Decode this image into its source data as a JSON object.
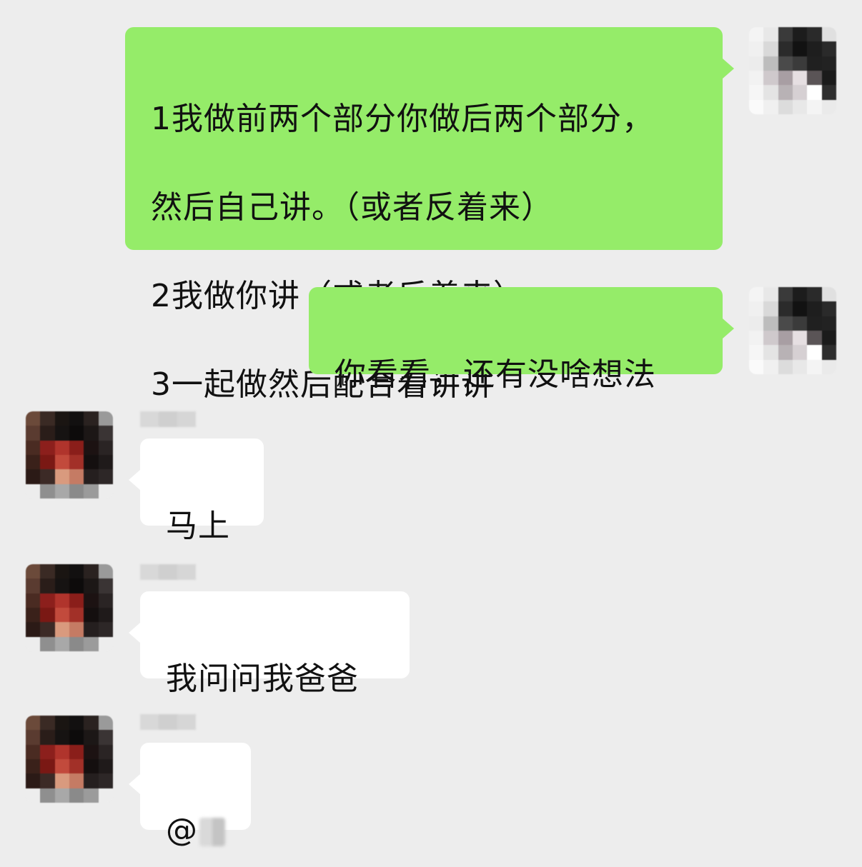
{
  "chat": {
    "messages": [
      {
        "sender": "me",
        "lines": [
          "1我做前两个部分你做后两个部分，",
          "然后自己讲。（或者反着来）",
          "2我做你讲（或者反着来）。",
          "3一起做然后配合着讲讲"
        ]
      },
      {
        "sender": "me",
        "text": "你看看，还有没啥想法"
      },
      {
        "sender": "other",
        "text": "马上"
      },
      {
        "sender": "other",
        "text": "我问问我爸爸"
      },
      {
        "sender": "other",
        "text": "@"
      }
    ]
  },
  "colors": {
    "background": "#ededed",
    "my_bubble": "#95ec69",
    "their_bubble": "#ffffff",
    "text": "#111111"
  },
  "icons": {
    "my_avatar": "pixelated-avatar",
    "their_avatar": "pixelated-avatar"
  }
}
